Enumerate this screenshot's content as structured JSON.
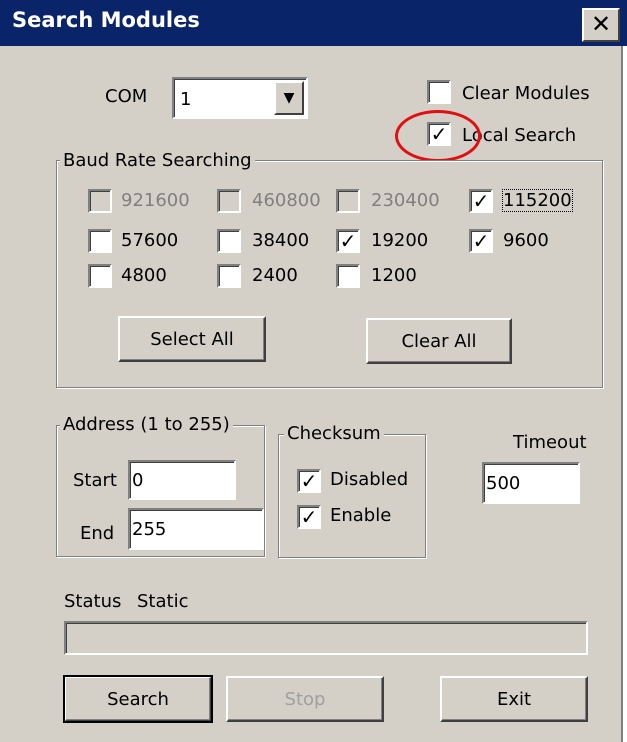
{
  "window": {
    "title": "Search Modules",
    "close_glyph": "✕"
  },
  "com": {
    "label": "COM",
    "value": "1",
    "arrow": "▼"
  },
  "clear_modules": {
    "label": "Clear Modules",
    "checked": false
  },
  "local_search": {
    "label": "Local Search",
    "checked": true
  },
  "baud": {
    "title": "Baud Rate Searching",
    "rates": [
      {
        "label": "921600",
        "checked": false,
        "enabled": false
      },
      {
        "label": "460800",
        "checked": false,
        "enabled": false
      },
      {
        "label": "230400",
        "checked": false,
        "enabled": false
      },
      {
        "label": "115200",
        "checked": true,
        "enabled": true
      },
      {
        "label": "57600",
        "checked": false,
        "enabled": true
      },
      {
        "label": "38400",
        "checked": false,
        "enabled": true
      },
      {
        "label": "19200",
        "checked": true,
        "enabled": true
      },
      {
        "label": "9600",
        "checked": true,
        "enabled": true
      },
      {
        "label": "4800",
        "checked": false,
        "enabled": true
      },
      {
        "label": "2400",
        "checked": false,
        "enabled": true
      },
      {
        "label": "1200",
        "checked": false,
        "enabled": true
      }
    ],
    "select_all": "Select All",
    "clear_all": "Clear All"
  },
  "address": {
    "title": "Address (1 to 255)",
    "start_label": "Start",
    "start_value": "0",
    "end_label": "End",
    "end_value": "255"
  },
  "checksum": {
    "title": "Checksum",
    "disabled_label": "Disabled",
    "disabled_checked": true,
    "enable_label": "Enable",
    "enable_checked": true
  },
  "timeout": {
    "label": "Timeout",
    "value": "500"
  },
  "status": {
    "label": "Status",
    "value": "Static",
    "progress": 0
  },
  "buttons": {
    "search": "Search",
    "stop": "Stop",
    "exit": "Exit"
  },
  "colors": {
    "titlebar": "#0a246a",
    "face": "#d4d0c8",
    "annotation": "#e01010"
  }
}
